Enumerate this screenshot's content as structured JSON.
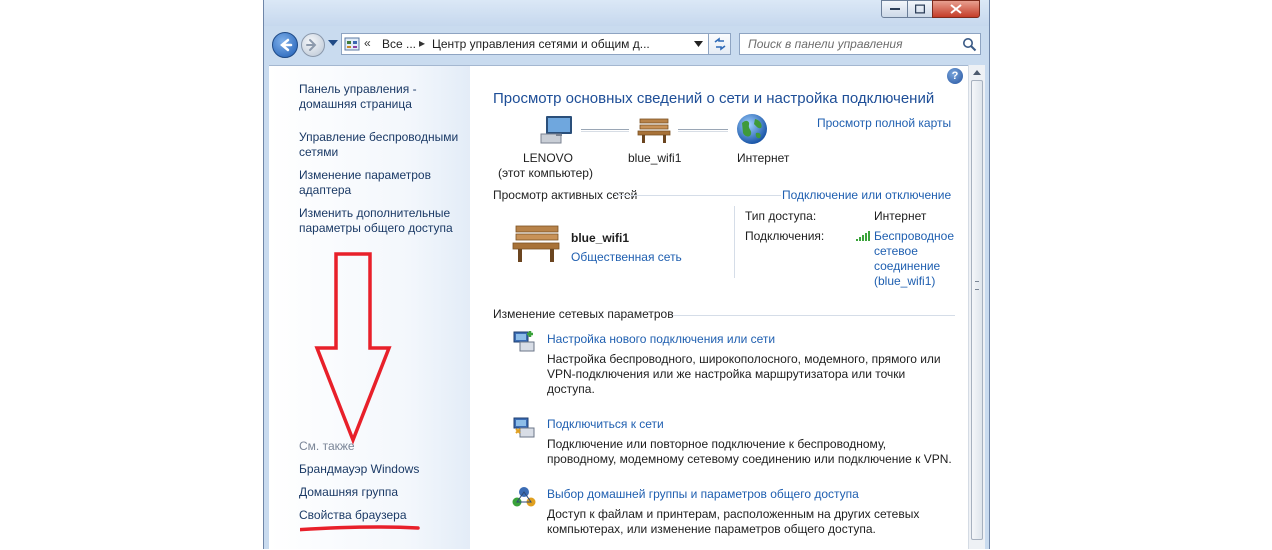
{
  "address": {
    "all_label": "Все ...",
    "path": "Центр управления сетями и общим д...",
    "search_placeholder": "Поиск в панели управления"
  },
  "sidebar": {
    "items": [
      {
        "label": "Панель управления - домашняя страница"
      },
      {
        "label": "Управление беспроводными сетями"
      },
      {
        "label": "Изменение параметров адаптера"
      },
      {
        "label": "Изменить дополнительные параметры общего доступа"
      }
    ],
    "see_also_title": "См. также",
    "see_also": [
      {
        "label": "Брандмауэр Windows"
      },
      {
        "label": "Домашняя группа"
      },
      {
        "label": "Свойства браузера"
      }
    ]
  },
  "main": {
    "title": "Просмотр основных сведений о сети и настройка подключений",
    "full_map_link": "Просмотр полной карты",
    "map": {
      "computer_name": "LENOVO",
      "computer_sub": "(этот компьютер)",
      "network_name": "blue_wifi1",
      "internet_label": "Интернет"
    },
    "active_networks": {
      "header": "Просмотр активных сетей",
      "connect_link": "Подключение или отключение",
      "network_name": "blue_wifi1",
      "network_type": "Общественная сеть",
      "access_type_label": "Тип доступа:",
      "access_type_value": "Интернет",
      "connections_label": "Подключения:",
      "connection_line1": "Беспроводное",
      "connection_line2": "сетевое",
      "connection_line3": "соединение",
      "connection_line4": "(blue_wifi1)"
    },
    "change_settings": {
      "header": "Изменение сетевых параметров",
      "items": [
        {
          "title": "Настройка нового подключения или сети",
          "desc_line1": "Настройка беспроводного, широкополосного, модемного, прямого или",
          "desc_line2": "VPN-подключения или же настройка маршрутизатора или точки",
          "desc_line3": "доступа."
        },
        {
          "title": "Подключиться к сети",
          "desc_line1": "Подключение или повторное подключение к беспроводному,",
          "desc_line2": "проводному, модемному сетевому соединению или подключение к VPN."
        },
        {
          "title": "Выбор домашней группы и параметров общего доступа",
          "desc_line1": "Доступ к файлам и принтерам, расположенным на других сетевых",
          "desc_line2": "компьютерах, или изменение параметров общего доступа."
        }
      ]
    }
  },
  "colors": {
    "link": "#1f5fb0",
    "title": "#1e4e97",
    "annotation_red": "#e8202a"
  },
  "icons": [
    "back-arrow-icon",
    "forward-arrow-icon",
    "refresh-icon",
    "search-icon",
    "help-icon",
    "computer-icon",
    "bench-icon",
    "globe-icon",
    "signal-icon",
    "new-connection-icon",
    "connect-network-icon",
    "homegroup-icon"
  ]
}
